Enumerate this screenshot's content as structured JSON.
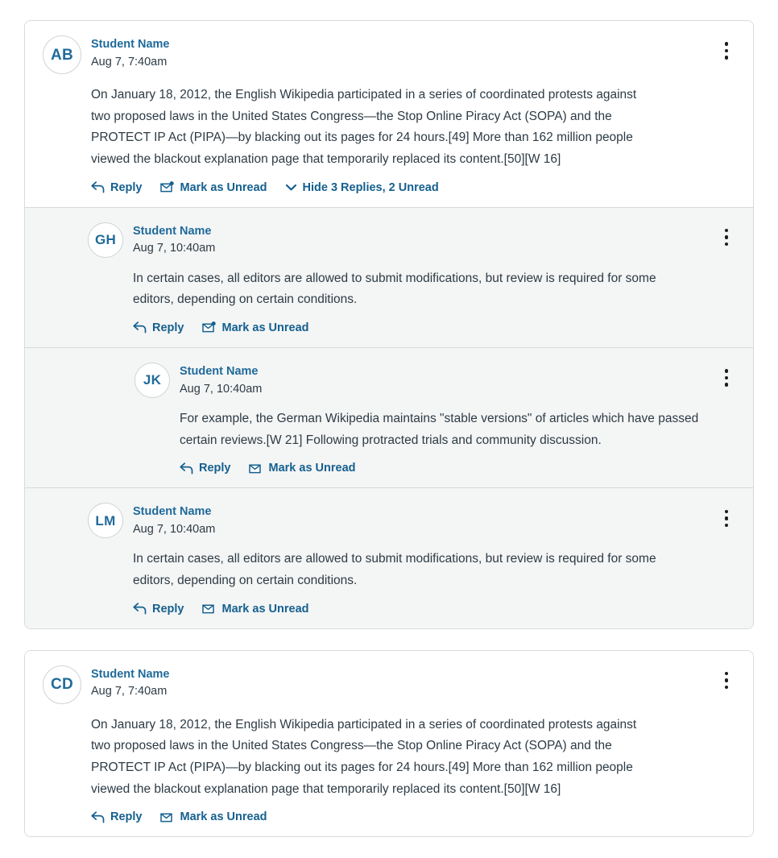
{
  "theme": {
    "page_background": "#ffffff",
    "card_background": "#ffffff",
    "reply_background": "#f4f5f5",
    "border_color": "#d7dade",
    "link_color": "#15608f",
    "author_color": "#1f6a9a",
    "avatar_color": "#206b9b",
    "text_color": "#2d3b45"
  },
  "labels": {
    "reply": "Reply",
    "mark_as_unread": "Mark as Unread",
    "more_options": "Manage Discussion",
    "reply_icon": "reply-arrow-icon",
    "unread_icon": "envelope-unread-icon",
    "read_icon": "envelope-icon",
    "kebab_icon": "kebab-menu-icon",
    "chevron_icon": "chevron-down-icon"
  },
  "threads": [
    {
      "id": "thread-1",
      "root": {
        "initials": "AB",
        "author": "Student Name",
        "timestamp": "Aug 7, 7:40am",
        "body": "On January 18, 2012, the English Wikipedia participated in a series of coordinated protests against two proposed laws in the United States Congress—the Stop Online Piracy Act (SOPA) and the PROTECT IP Act (PIPA)—by blacking out its pages for 24 hours.[49] More than 162 million people viewed the blackout explanation page that temporarily replaced its content.[50][W 16]",
        "unread": true,
        "toggle_replies_label": "Hide 3 Replies, 2 Unread"
      },
      "replies": [
        {
          "initials": "GH",
          "author": "Student Name",
          "timestamp": "Aug 7, 10:40am",
          "body": "In certain cases, all editors are allowed to submit modifications, but review is required for some editors, depending on certain conditions.",
          "unread": true,
          "depth": 1
        },
        {
          "initials": "JK",
          "author": "Student Name",
          "timestamp": "Aug 7, 10:40am",
          "body": "For example, the German Wikipedia maintains \"stable versions\" of articles which have passed certain reviews.[W 21] Following protracted trials and community discussion.",
          "unread": false,
          "depth": 2
        },
        {
          "initials": "LM",
          "author": "Student Name",
          "timestamp": "Aug 7, 10:40am",
          "body": "In certain cases, all editors are allowed to submit modifications, but review is required for some editors, depending on certain conditions.",
          "unread": false,
          "depth": 1
        }
      ]
    },
    {
      "id": "thread-2",
      "root": {
        "initials": "CD",
        "author": "Student Name",
        "timestamp": "Aug 7, 7:40am",
        "body": "On January 18, 2012, the English Wikipedia participated in a series of coordinated protests against two proposed laws in the United States Congress—the Stop Online Piracy Act (SOPA) and the PROTECT IP Act (PIPA)—by blacking out its pages for 24 hours.[49] More than 162 million people viewed the blackout explanation page that temporarily replaced its content.[50][W 16]",
        "unread": false,
        "toggle_replies_label": ""
      },
      "replies": []
    }
  ]
}
